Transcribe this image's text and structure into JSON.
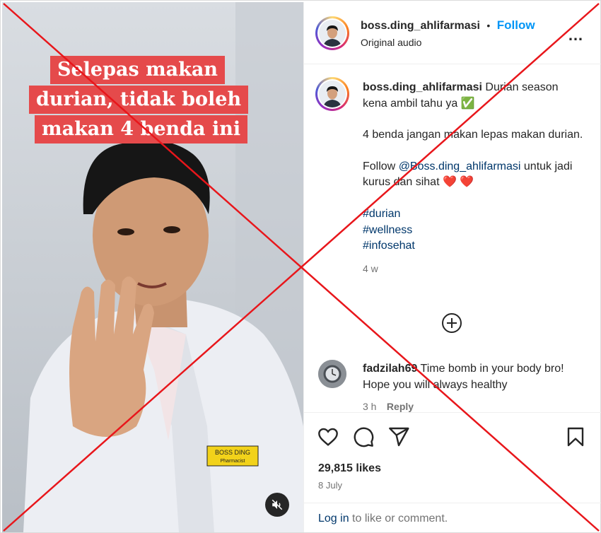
{
  "video": {
    "caption_lines": [
      "Selepas makan",
      "durian, tidak boleh",
      "makan 4 benda ini"
    ],
    "badge_name": "BOSS DING",
    "badge_title": "Pharmacist",
    "mute_icon": "speaker-muted-icon"
  },
  "header": {
    "username": "boss.ding_ahlifarmasi",
    "separator": "•",
    "follow_label": "Follow",
    "audio_label": "Original audio",
    "more_icon": "more-options-icon",
    "more_label": "…"
  },
  "post": {
    "username": "boss.ding_ahlifarmasi",
    "caption_line1": "Durian season",
    "caption_line2": "kena ambil tahu ya",
    "checkmark": "✅",
    "paragraph2": "4 benda jangan makan lepas makan durian.",
    "follow_prefix": "Follow",
    "mention": "@Boss.ding_ahlifarmasi",
    "follow_suffix": "untuk jadi kurus dan sihat",
    "hearts": "❤️ ❤️",
    "hashtags": [
      "#durian",
      "#wellness",
      "#infosehat"
    ],
    "age": "4 w"
  },
  "comment": {
    "username": "fadzilah69",
    "text": "Time bomb in your body bro! Hope you will always healthy",
    "age": "3 h",
    "reply_label": "Reply"
  },
  "actions": {
    "like_icon": "heart-icon",
    "comment_icon": "comment-icon",
    "share_icon": "share-icon",
    "save_icon": "bookmark-icon",
    "likes": "29,815 likes",
    "date": "8 July"
  },
  "login": {
    "link_label": "Log in",
    "suffix": "to like or comment."
  },
  "colors": {
    "accent": "#0095f6",
    "link": "#00376b",
    "overlay_cross": "#e8161b",
    "caption_bg": "#e54a4b"
  }
}
